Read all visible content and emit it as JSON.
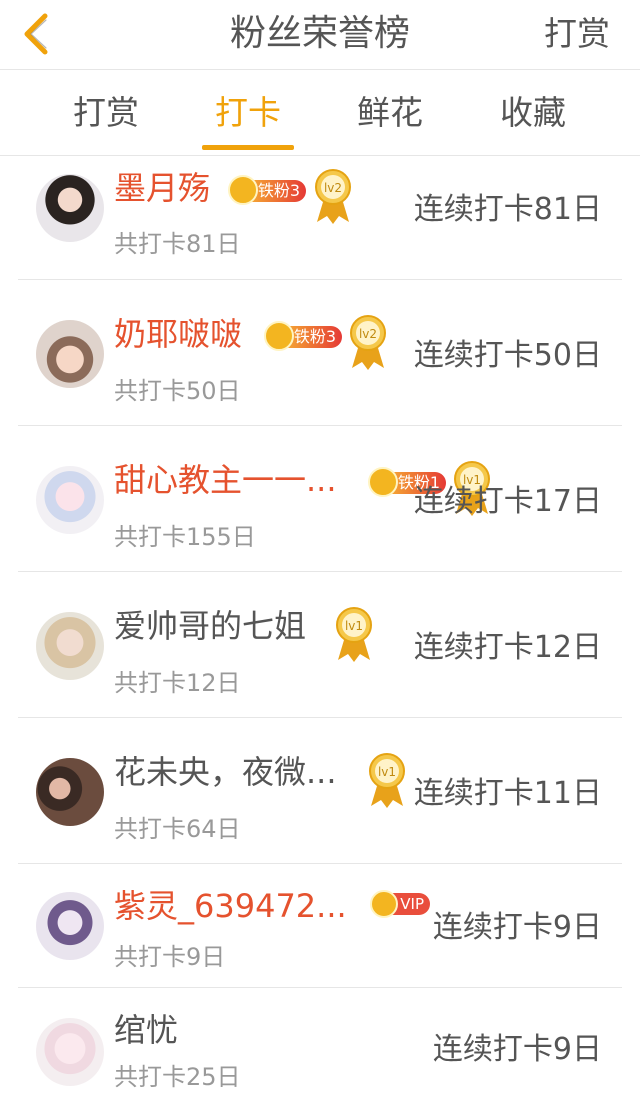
{
  "header": {
    "title": "粉丝荣誉榜",
    "action": "打赏"
  },
  "tabs": [
    {
      "label": "打赏"
    },
    {
      "label": "打卡"
    },
    {
      "label": "鲜花"
    },
    {
      "label": "收藏"
    }
  ],
  "active_tab": "打卡",
  "rows": [
    {
      "name": "墨月殇",
      "fan_badge": "铁粉3",
      "level": "lv2",
      "streak": "连续打卡81日",
      "total": "共打卡81日"
    },
    {
      "name": "奶耶啵啵",
      "fan_badge": "铁粉3",
      "level": "lv2",
      "streak": "连续打卡50日",
      "total": "共打卡50日"
    },
    {
      "name": "甜心教主一一...",
      "fan_badge": "铁粉1",
      "level": "lv1",
      "streak": "连续打卡17日",
      "total": "共打卡155日"
    },
    {
      "name": "爱帅哥的七姐",
      "level": "lv1",
      "streak": "连续打卡12日",
      "total": "共打卡12日"
    },
    {
      "name": "花未央，夜微...",
      "level": "lv1",
      "streak": "连续打卡11日",
      "total": "共打卡64日"
    },
    {
      "name": "紫灵_639472...",
      "vip_badge": "VIP",
      "streak": "连续打卡9日",
      "total": "共打卡9日"
    },
    {
      "name": "绾忧",
      "streak": "连续打卡9日",
      "total": "共打卡25日"
    }
  ],
  "colors": {
    "accent": "#f0a20b",
    "highlight_name": "#e5522e",
    "separator": "#e6e6e6"
  }
}
